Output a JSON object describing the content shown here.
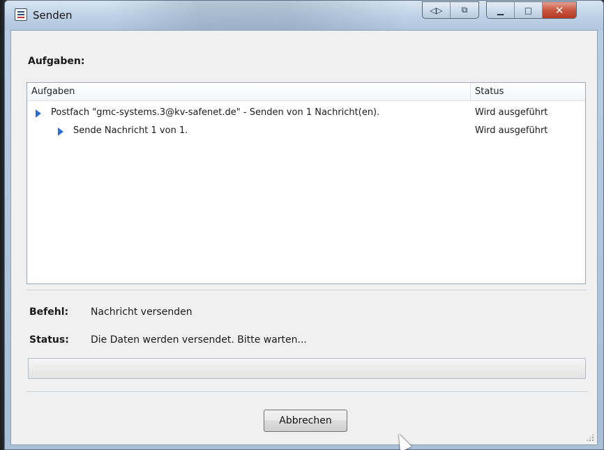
{
  "window": {
    "title": "Senden",
    "caption_buttons": [
      {
        "icon": "nav-arrows-icon",
        "glyph": "◁▷"
      },
      {
        "icon": "window-pin-icon",
        "glyph": "⧉"
      },
      {
        "icon": "minimize-icon",
        "glyph": "▁"
      },
      {
        "icon": "maximize-icon",
        "glyph": "□"
      },
      {
        "icon": "close-icon",
        "glyph": "✕"
      }
    ]
  },
  "tasks": {
    "section_label": "Aufgaben:",
    "columns": [
      "Aufgaben",
      "Status"
    ],
    "rows": [
      {
        "label": "Postfach \"gmc-systems.3@kv-safenet.de\" - Senden von 1 Nachricht(en).",
        "status": "Wird ausgeführt",
        "level": 0
      },
      {
        "label": "Sende Nachricht 1 von 1.",
        "status": "Wird ausgeführt",
        "level": 1
      }
    ]
  },
  "details": {
    "command_label": "Befehl:",
    "command_value": "Nachricht versenden",
    "status_label": "Status:",
    "status_value": "Die Daten werden versendet. Bitte warten..."
  },
  "progress": {
    "fraction": 0.0
  },
  "buttons": {
    "cancel_label": "Abbrechen"
  },
  "colors": {
    "row_arrow": "#2b6fcf",
    "close_button": "#c8563f"
  }
}
